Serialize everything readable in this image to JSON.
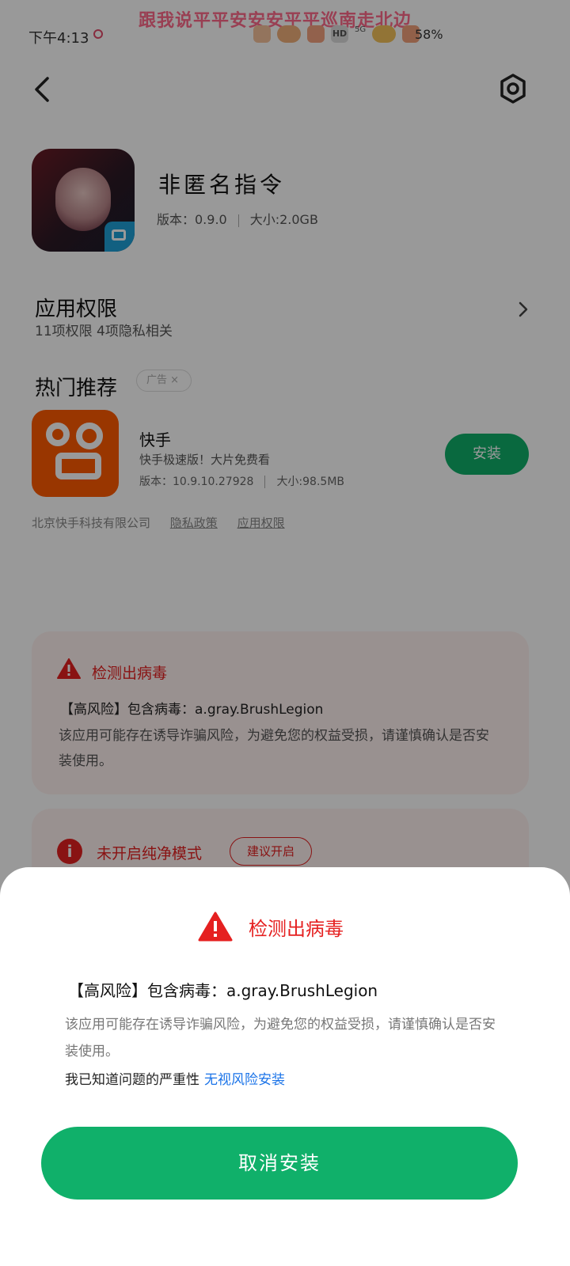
{
  "status_bar": {
    "banner": "跟我说平平安安安平平巡南走北边",
    "time": "下午4:13",
    "network": "5G",
    "hd": "HD",
    "battery": "58%"
  },
  "app": {
    "name": "非匿名指令",
    "version": "版本：0.9.0",
    "size": "大小:2.0GB"
  },
  "permissions": {
    "title": "应用权限",
    "subtitle": "11项权限 4项隐私相关"
  },
  "recommend": {
    "title": "热门推荐",
    "ad_label": "广告 ×",
    "item": {
      "name": "快手",
      "desc": "快手极速版！大片免费看",
      "version": "版本：10.9.10.27928",
      "size": "大小:98.5MB",
      "install_label": "安装"
    },
    "company": "北京快手科技有限公司",
    "privacy_link": "隐私政策",
    "permission_link": "应用权限"
  },
  "virus_card": {
    "title": "检测出病毒",
    "risk_line": "【高风险】包含病毒：a.gray.BrushLegion",
    "desc": "该应用可能存在诱导诈骗风险，为避免您的权益受损，请谨慎确认是否安装使用。"
  },
  "pure_mode_card": {
    "title": "未开启纯净模式",
    "suggest_label": "建议开启"
  },
  "dialog": {
    "title": "检测出病毒",
    "risk_line": "【高风险】包含病毒：a.gray.BrushLegion",
    "desc": "该应用可能存在诱导诈骗风险，为避免您的权益受损，请谨慎确认是否安装使用。",
    "ack_text": "我已知道问题的严重性",
    "ignore_link": "无视风险安装",
    "cancel_label": "取消安装"
  },
  "colors": {
    "accent_green": "#10b06a",
    "danger_red": "#e52020",
    "link_blue": "#1a73e8"
  }
}
